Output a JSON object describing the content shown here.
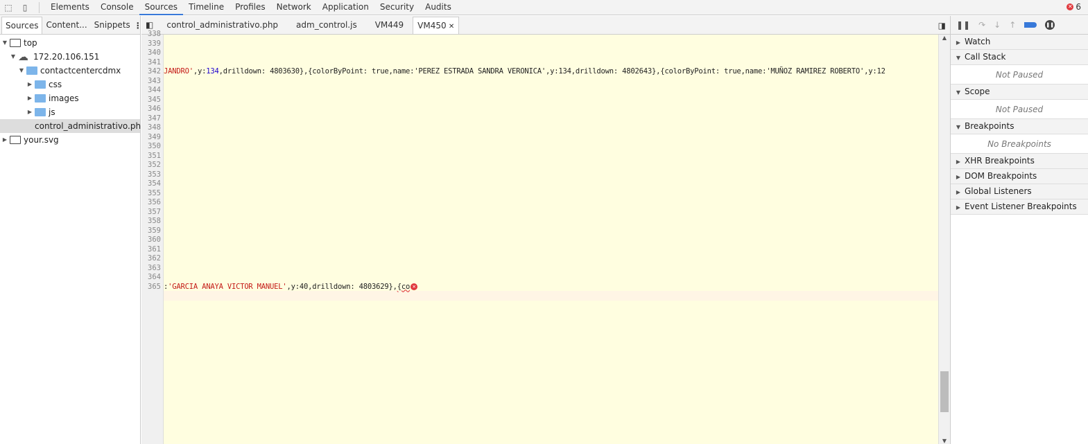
{
  "toolbar": {
    "panels": [
      "Elements",
      "Console",
      "Sources",
      "Timeline",
      "Profiles",
      "Network",
      "Application",
      "Security",
      "Audits"
    ],
    "active": "Sources",
    "error_count": "6"
  },
  "navigator": {
    "tabs": [
      "Sources",
      "Content...",
      "Snippets"
    ],
    "tree": [
      {
        "label": "top",
        "depth": 0,
        "icon": "frame-icon",
        "expanded": true
      },
      {
        "label": "172.20.106.151",
        "depth": 1,
        "icon": "cloud-icon",
        "expanded": true
      },
      {
        "label": "contactcentercdmx",
        "depth": 2,
        "icon": "folder-icon",
        "expanded": true
      },
      {
        "label": "css",
        "depth": 3,
        "icon": "folder-icon",
        "expanded": false
      },
      {
        "label": "images",
        "depth": 3,
        "icon": "folder-icon",
        "expanded": false
      },
      {
        "label": "js",
        "depth": 3,
        "icon": "folder-icon",
        "expanded": false
      },
      {
        "label": "control_administrativo.php",
        "depth": 3,
        "icon": "file-icon",
        "selected": true
      },
      {
        "label": "your.svg",
        "depth": 0,
        "icon": "frame-icon",
        "expanded": false
      }
    ]
  },
  "editor": {
    "tabs": [
      "control_administrativo.php",
      "adm_control.js",
      "VM449",
      "VM450"
    ],
    "active_tab": "VM450",
    "line_numbers": [
      "338",
      "339",
      "340",
      "341",
      "342",
      "343",
      "344",
      "345",
      "346",
      "347",
      "348",
      "349",
      "350",
      "351",
      "352",
      "353",
      "354",
      "355",
      "356",
      "357",
      "358",
      "359",
      "360",
      "361",
      "362",
      "363",
      "364",
      "365"
    ],
    "line342": [
      {
        "t": "JANDRO'",
        "c": "str"
      },
      {
        "t": ",y:",
        "c": ""
      },
      {
        "t": "134",
        "c": "num"
      },
      {
        "t": ",drilldown: 4803630},{colorByPoint: true,name:'PEREZ ESTRADA SANDRA VERONICA',y:134,drilldown: 4802643},{colorByPoint: true,name:'MUÑOZ RAMIREZ ROBERTO',y:12",
        "c": ""
      }
    ],
    "line365": [
      {
        "t": ":",
        "c": ""
      },
      {
        "t": "'GARCIA ANAYA VICTOR MANUEL'",
        "c": "str"
      },
      {
        "t": ",y:40,drilldown: 4803629},",
        "c": ""
      },
      {
        "t": "{co",
        "c": "squig"
      }
    ]
  },
  "debugger": {
    "sections": [
      {
        "title": "Watch",
        "expanded": false
      },
      {
        "title": "Call Stack",
        "expanded": true,
        "empty": "Not Paused"
      },
      {
        "title": "Scope",
        "expanded": true,
        "empty": "Not Paused"
      },
      {
        "title": "Breakpoints",
        "expanded": true,
        "empty": "No Breakpoints"
      },
      {
        "title": "XHR Breakpoints",
        "expanded": false
      },
      {
        "title": "DOM Breakpoints",
        "expanded": false
      },
      {
        "title": "Global Listeners",
        "expanded": false
      },
      {
        "title": "Event Listener Breakpoints",
        "expanded": false
      }
    ]
  },
  "colors": {
    "accent": "#3879d9",
    "string": "#c41a16",
    "number": "#1c00cf",
    "editor_bg": "#fffee0",
    "error": "#e0393e"
  }
}
